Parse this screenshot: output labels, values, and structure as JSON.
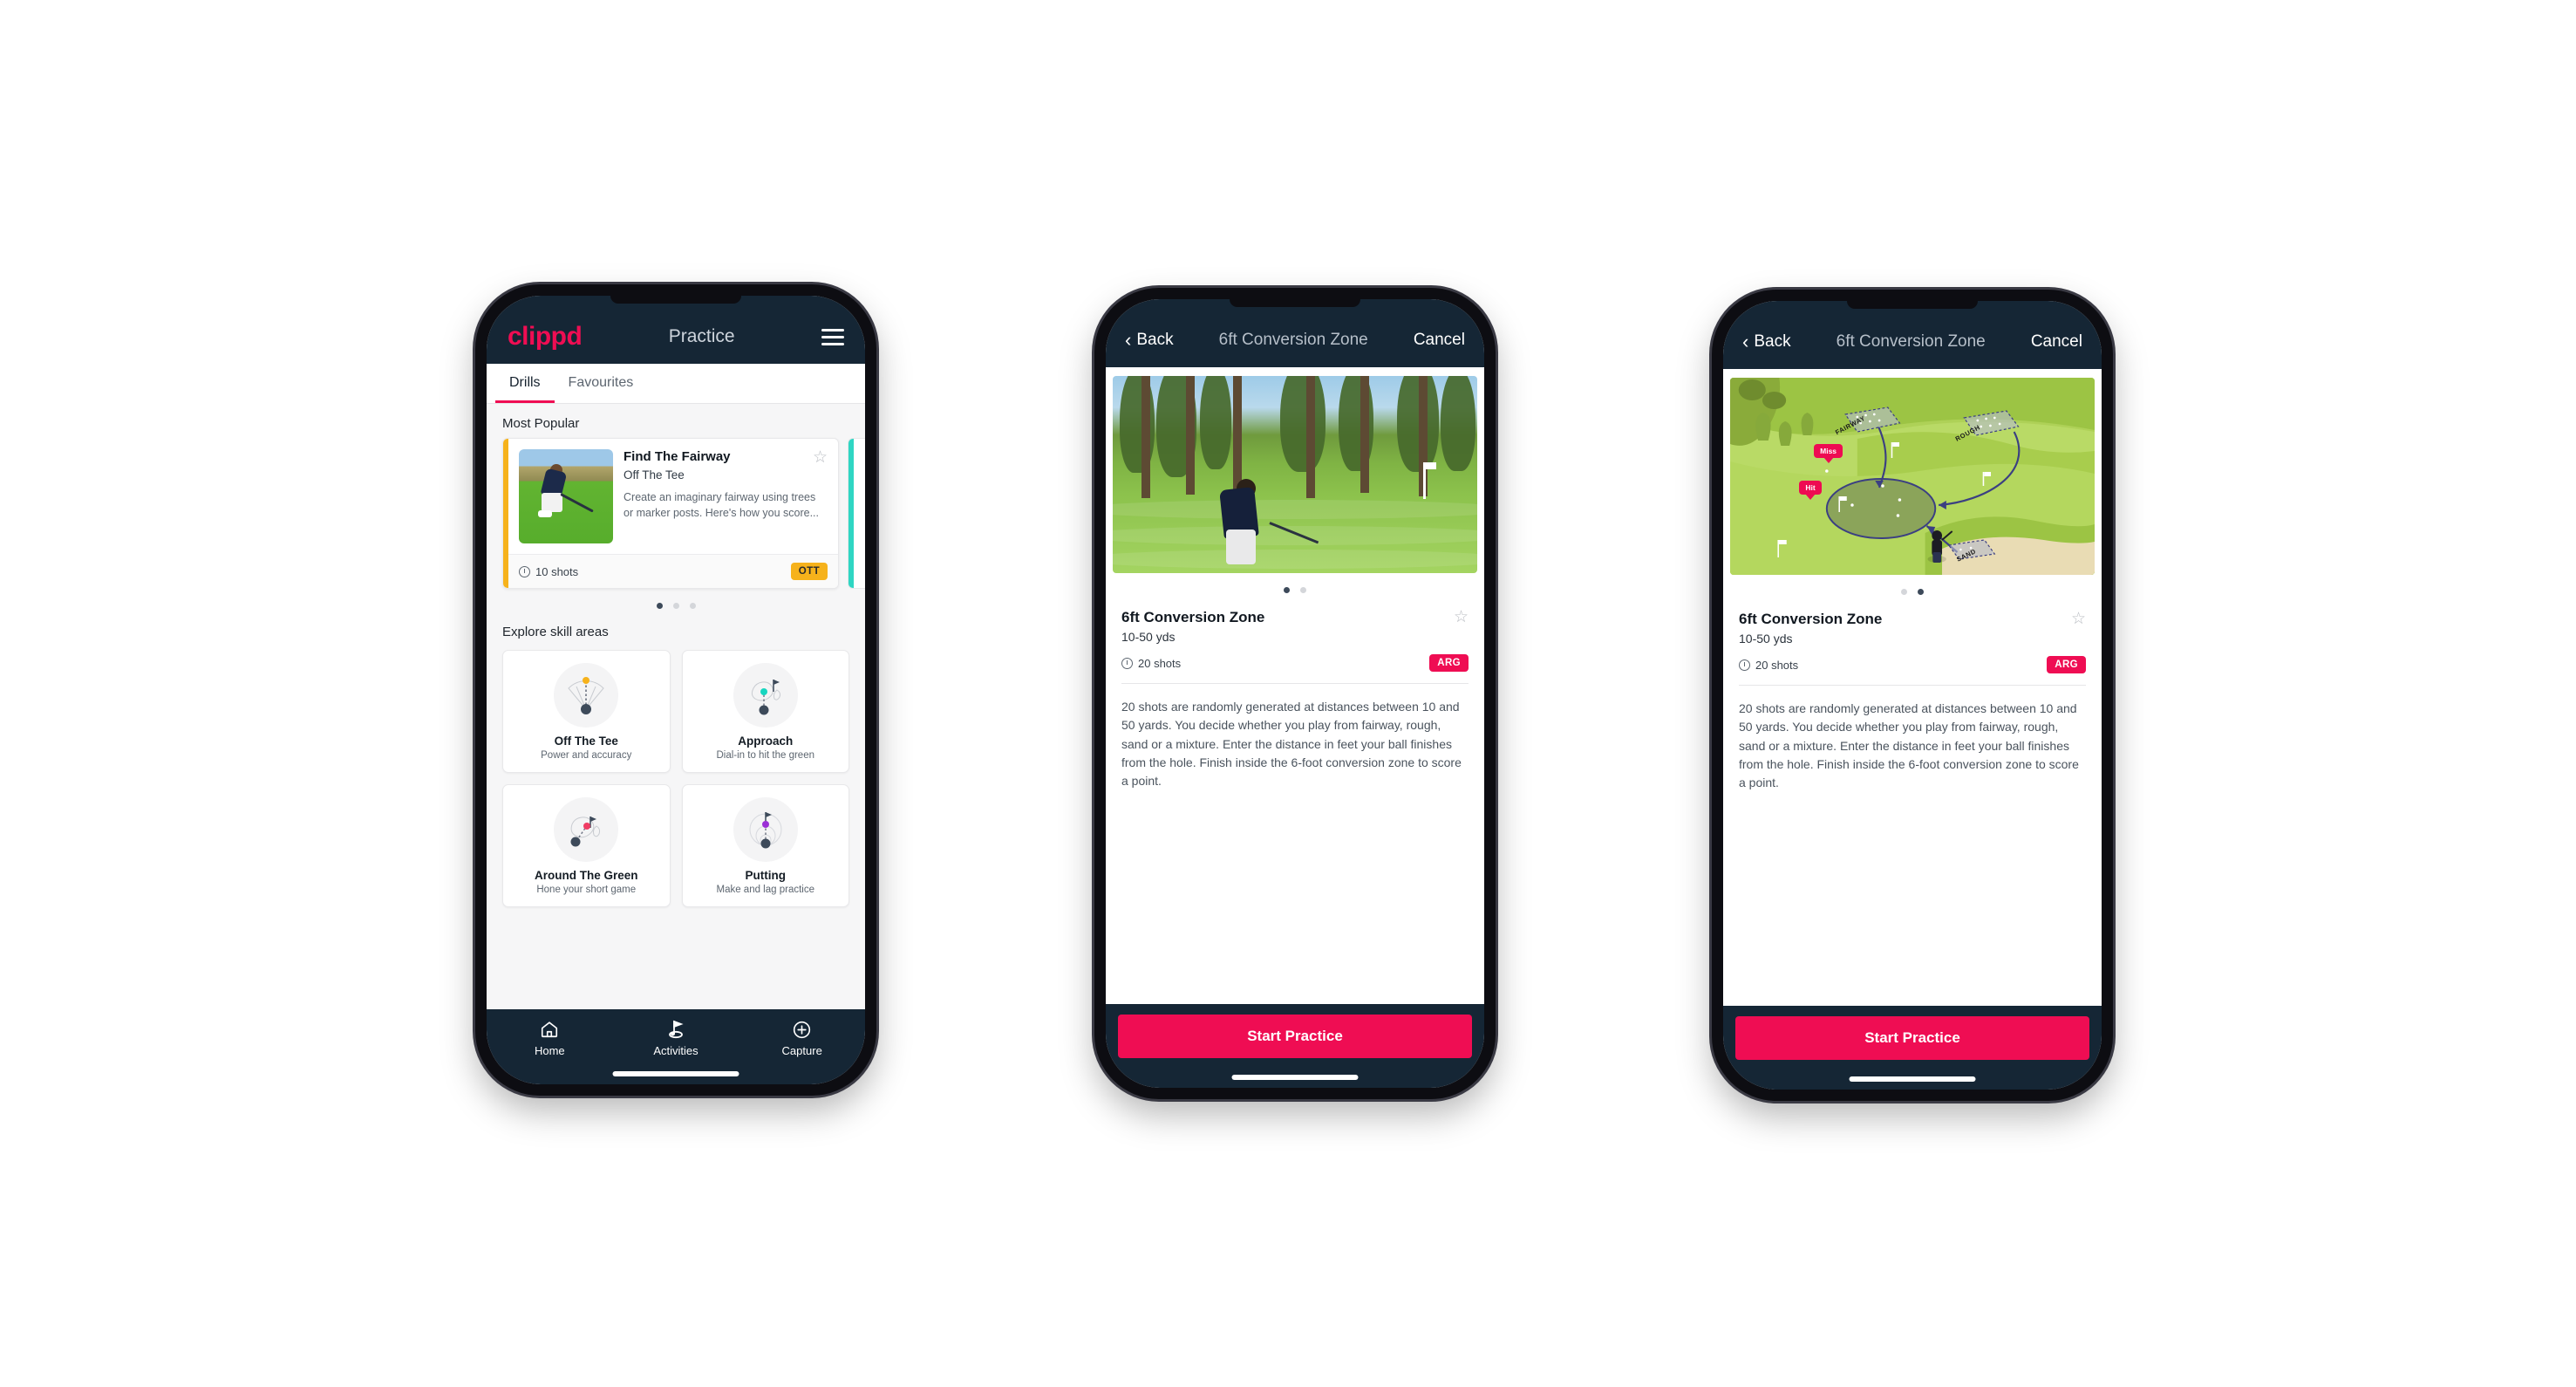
{
  "phone1": {
    "header": {
      "brand": "clippd",
      "title": "Practice",
      "menu_icon": "hamburger-icon"
    },
    "tabs": [
      {
        "label": "Drills",
        "active": true
      },
      {
        "label": "Favourites",
        "active": false
      }
    ],
    "most_popular": {
      "section_label": "Most Popular",
      "card": {
        "title": "Find The Fairway",
        "subtitle": "Off The Tee",
        "description": "Create an imaginary fairway using trees or marker posts. Here's how you score...",
        "shots": "10 shots",
        "badge": "OTT",
        "badge_color": "#f6b21b",
        "accent_color": "#f6b21b",
        "star_icon": "star-outline-icon"
      },
      "dots": [
        {
          "active": true
        },
        {
          "active": false
        },
        {
          "active": false
        }
      ]
    },
    "skill_areas": {
      "section_label": "Explore skill areas",
      "items": [
        {
          "name": "Off The Tee",
          "desc": "Power and accuracy",
          "icon": "tee-fan-icon"
        },
        {
          "name": "Approach",
          "desc": "Dial-in to hit the green",
          "icon": "approach-green-icon"
        },
        {
          "name": "Around The Green",
          "desc": "Hone your short game",
          "icon": "around-green-icon"
        },
        {
          "name": "Putting",
          "desc": "Make and lag practice",
          "icon": "putting-rings-icon"
        }
      ]
    },
    "bottom_nav": [
      {
        "label": "Home",
        "icon": "home-icon",
        "active": false
      },
      {
        "label": "Activities",
        "icon": "golf-flag-icon",
        "active": true
      },
      {
        "label": "Capture",
        "icon": "plus-circle-icon",
        "active": false
      }
    ]
  },
  "phone2": {
    "nav": {
      "back": "Back",
      "title": "6ft Conversion Zone",
      "cancel": "Cancel",
      "back_icon": "chevron-left-icon"
    },
    "hero_kind": "photo",
    "dots": [
      {
        "active": true
      },
      {
        "active": false
      }
    ],
    "detail": {
      "title": "6ft Conversion Zone",
      "subtitle": "10-50 yds",
      "shots": "20 shots",
      "badge": "ARG",
      "badge_color": "#ef0d53",
      "star_icon": "star-outline-icon",
      "description": "20 shots are randomly generated at distances between 10 and 50 yards. You decide whether you play from fairway, rough, sand or a mixture. Enter the distance in feet your ball finishes from the hole. Finish inside the 6-foot conversion zone to score a point."
    },
    "cta": "Start Practice"
  },
  "phone3": {
    "nav": {
      "back": "Back",
      "title": "6ft Conversion Zone",
      "cancel": "Cancel",
      "back_icon": "chevron-left-icon"
    },
    "hero_kind": "illustration",
    "illustration": {
      "labels": [
        "FAIRWAY",
        "ROUGH",
        "SAND"
      ],
      "tags": [
        "Miss",
        "Hit"
      ]
    },
    "dots": [
      {
        "active": false
      },
      {
        "active": true
      }
    ],
    "detail": {
      "title": "6ft Conversion Zone",
      "subtitle": "10-50 yds",
      "shots": "20 shots",
      "badge": "ARG",
      "badge_color": "#ef0d53",
      "star_icon": "star-outline-icon",
      "description": "20 shots are randomly generated at distances between 10 and 50 yards. You decide whether you play from fairway, rough, sand or a mixture. Enter the distance in feet your ball finishes from the hole. Finish inside the 6-foot conversion zone to score a point."
    },
    "cta": "Start Practice"
  }
}
